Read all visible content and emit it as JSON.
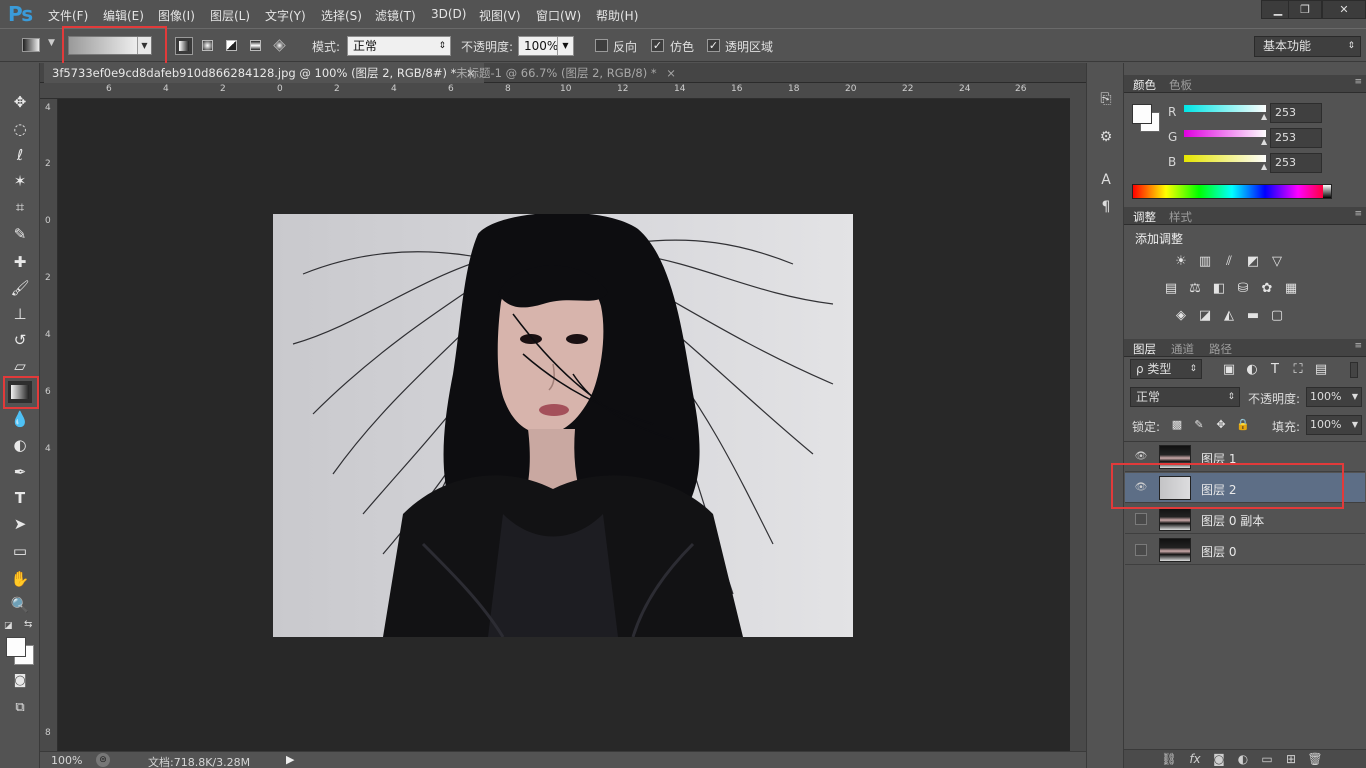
{
  "app": {
    "logo": "Ps"
  },
  "menu": [
    "文件(F)",
    "编辑(E)",
    "图像(I)",
    "图层(L)",
    "文字(Y)",
    "选择(S)",
    "滤镜(T)",
    "3D(D)",
    "视图(V)",
    "窗口(W)",
    "帮助(H)"
  ],
  "window_controls": [
    "minimize-icon",
    "restore-icon",
    "close-icon"
  ],
  "options": {
    "mode_label": "模式:",
    "mode_value": "正常",
    "opacity_label": "不透明度:",
    "opacity_value": "100%",
    "reverse_label": "反向",
    "reverse_checked": false,
    "dither_label": "仿色",
    "dither_checked": true,
    "transparency_label": "透明区域",
    "transparency_checked": true,
    "workspace": "基本功能",
    "gradient_type_icons": [
      "linear-gradient-icon",
      "radial-gradient-icon",
      "angle-gradient-icon",
      "reflected-gradient-icon",
      "diamond-gradient-icon"
    ]
  },
  "tabs": [
    {
      "label": "3f5733ef0e9cd8dafeb910d866284128.jpg @ 100% (图层 2, RGB/8#) *",
      "close": "×",
      "active": true
    },
    {
      "label": "未标题-1 @ 66.7% (图层 2, RGB/8) *",
      "close": "×",
      "active": false
    }
  ],
  "ruler": {
    "h_labels": [
      "6",
      "4",
      "2",
      "0",
      "2",
      "4",
      "6",
      "8",
      "10",
      "12",
      "14",
      "16",
      "18",
      "20",
      "22",
      "24",
      "26"
    ],
    "v_labels": [
      "4",
      "2",
      "0",
      "2",
      "4",
      "6",
      "4",
      "8"
    ]
  },
  "status": {
    "zoom": "100%",
    "doc": "文档:718.8K/3.28M"
  },
  "color_panel": {
    "tabs": [
      "颜色",
      "色板"
    ],
    "channels": [
      {
        "label": "R",
        "value": "253"
      },
      {
        "label": "G",
        "value": "253"
      },
      {
        "label": "B",
        "value": "253"
      }
    ],
    "colors": {
      "r_slider": "#00e5e5",
      "g_slider": "#e000e0",
      "b_slider": "#e5e500"
    }
  },
  "adjust_panel": {
    "tabs": [
      "调整",
      "样式"
    ],
    "title": "添加调整"
  },
  "layers_panel": {
    "tabs": [
      "图层",
      "通道",
      "路径"
    ],
    "filter_label": "ρ 类型",
    "blend_mode": "正常",
    "opacity_label": "不透明度:",
    "opacity_value": "100%",
    "lock_label": "锁定:",
    "fill_label": "填充:",
    "fill_value": "100%",
    "layers": [
      {
        "name": "图层 1",
        "visible": true,
        "selected": false
      },
      {
        "name": "图层 2",
        "visible": true,
        "selected": true
      },
      {
        "name": "图层 0 副本",
        "visible": false,
        "selected": false
      },
      {
        "name": "图层 0",
        "visible": false,
        "selected": false
      }
    ]
  },
  "highlight_color": "#e23a3a",
  "accent_selected": "#5d6e86"
}
